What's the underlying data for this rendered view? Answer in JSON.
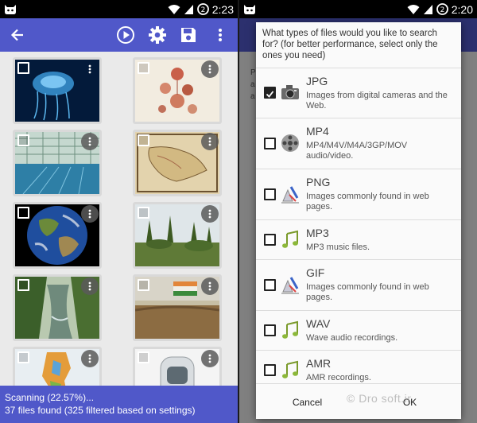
{
  "left": {
    "status": {
      "time": "2:23"
    },
    "toolbar": {
      "back_icon": "arrow-left-icon",
      "play_icon": "play-circle-icon",
      "settings_icon": "gear-icon",
      "save_icon": "floppy-disk-icon",
      "more_icon": "vertical-dots-icon"
    },
    "thumbnails": [
      {
        "subject": "jellyfish"
      },
      {
        "subject": "botanical-illustration"
      },
      {
        "subject": "indoor-pool"
      },
      {
        "subject": "antique-map"
      },
      {
        "subject": "earth-globe"
      },
      {
        "subject": "garden"
      },
      {
        "subject": "river-valley"
      },
      {
        "subject": "field-with-flag"
      },
      {
        "subject": "country-map"
      },
      {
        "subject": "retro-robot"
      }
    ],
    "scan": {
      "progress_text": "Scanning (22.57%)...",
      "files_text": "37 files found (325 filtered based on settings)",
      "progress_percent": 22.57
    }
  },
  "right": {
    "status": {
      "time": "2:20"
    },
    "dialog": {
      "title": "What types of files would you like to search for? (for better performance, select only the ones you need)",
      "options": [
        {
          "name": "JPG",
          "description": "Images from digital cameras and the Web.",
          "checked": true,
          "icon": "camera-icon"
        },
        {
          "name": "MP4",
          "description": "MP4/M4V/M4A/3GP/MOV audio/video.",
          "checked": false,
          "icon": "film-reel-icon"
        },
        {
          "name": "PNG",
          "description": "Images commonly found in web pages.",
          "checked": false,
          "icon": "paint-brush-icon"
        },
        {
          "name": "MP3",
          "description": "MP3 music files.",
          "checked": false,
          "icon": "music-note-icon"
        },
        {
          "name": "GIF",
          "description": "Images commonly found in web pages.",
          "checked": false,
          "icon": "paint-brush-icon"
        },
        {
          "name": "WAV",
          "description": "Wave audio recordings.",
          "checked": false,
          "icon": "music-note-icon"
        },
        {
          "name": "AMR",
          "description": "AMR recordings.",
          "checked": false,
          "icon": "music-note-icon"
        }
      ],
      "cancel_label": "Cancel",
      "ok_label": "OK"
    },
    "watermark": "© Dro soft.ir",
    "background_text": [
      "P",
      "a",
      "a"
    ]
  },
  "colors": {
    "accent": "#5058c9",
    "status_bar": "#000000"
  }
}
